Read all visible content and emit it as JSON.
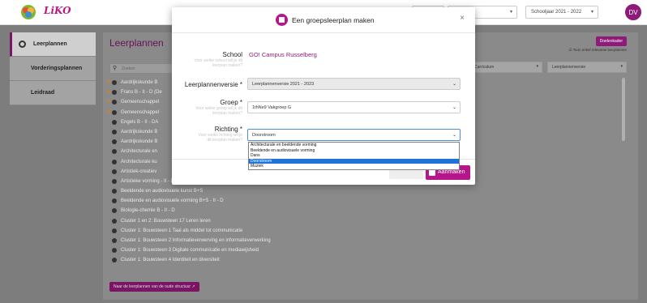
{
  "topbar": {
    "brand": "LiKO",
    "select1": "",
    "select2": "",
    "schoolyear": "Schooljaar 2021 - 2022",
    "avatar": "DV"
  },
  "sidebar": {
    "items": [
      {
        "label": "Leerplannen"
      },
      {
        "label": "Vorderingsplannen"
      },
      {
        "label": "Leidraad"
      }
    ]
  },
  "main": {
    "title": "Leerplannen",
    "new_button": "Doelenkader",
    "show_check": "Toon enkel relevante leerplannen",
    "search_placeholder": "Zoeken",
    "filter_curriculum": "Curriculum",
    "filter_version": "Leerplannenversie",
    "plans": [
      "Aardrijkskunde B",
      "Frans B - II - D (De",
      "Gemeenschappel",
      "Gemeenschappel",
      "Engels B - II - DA",
      "Aardrijkskunde B",
      "Aardrijkskunde B",
      "Architecturale en",
      "Architecturale ku",
      "Artistiek-creatiev",
      "Artistieke vorming - II - DDAA",
      "Beeldende en audiovisuele kunst B+S",
      "Beeldende en audiovisuele vorming B+S - II - D",
      "Biologie-chemie B - II - D",
      "Cluster 1 en 2: Bouwsteen 17 Leren leren",
      "Cluster 1: Bouwsteen 1 Taal als middel tot communicatie",
      "Cluster 1: Bouwsteen 2 Informatieverwerving en informatieverwerking",
      "Cluster 1: Bouwsteen 3 Digitale communicatie en mediawijsheid",
      "Cluster 1: Bouwsteen 4 Identiteit en diversiteit"
    ],
    "old_structure_link": "Naar de leerplannen van de oude structuur"
  },
  "modal": {
    "title": "Een groepsleerplan maken",
    "close": "×",
    "school_label": "School",
    "school_help": "Voor welke school wil je dit leerplan maken?",
    "school_value": "GO! Campus Russelberg",
    "version_label": "Leerplannenversie *",
    "version_value": "Leerplannenversie 2021 - 2023",
    "group_label": "Groep *",
    "group_help": "Voor welke groep wil je dit leerplan maken?",
    "group_value": "1thNe9 Vakgroep G",
    "direction_label": "Richting *",
    "direction_help": "Voor welke richting wil je dit leerplan maken?",
    "direction_value": "Doorstroom",
    "direction_options": [
      "Architecturale en beeldende vorming",
      "Beeldende en audiovisuele vorming",
      "Dans",
      "Doorstroom",
      "Muziek"
    ],
    "create_button": "Aanmaken"
  },
  "colors": {
    "brand": "#b5178a",
    "brand_dark": "#7a1464",
    "selection": "#1e73d9"
  }
}
